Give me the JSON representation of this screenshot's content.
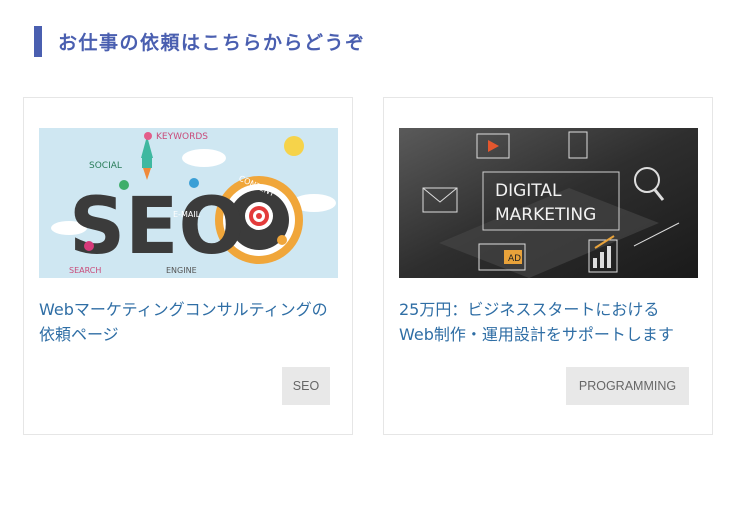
{
  "section": {
    "heading": "お仕事の依頼はこちらからどうぞ"
  },
  "cards": [
    {
      "image": {
        "words": [
          "SOCIAL",
          "KEYWORDS",
          "CONTENT",
          "E-MAIL",
          "SEARCH",
          "ENGINE",
          "SEO"
        ]
      },
      "title_lines": [
        "Webマーケティングコンサルティングの",
        "依頼ページ"
      ],
      "tag": "SEO"
    },
    {
      "image": {
        "words": [
          "DIGITAL",
          "MARKETING",
          "AD"
        ]
      },
      "title_lines": [
        "25万円：ビジネススタートにおける",
        "Web制作・運用設計をサポートします"
      ],
      "tag": "PROGRAMMING"
    }
  ],
  "colors": {
    "accent": "#4a5fb0",
    "link": "#2f6ea5",
    "tag_bg": "#e8e8e8"
  }
}
